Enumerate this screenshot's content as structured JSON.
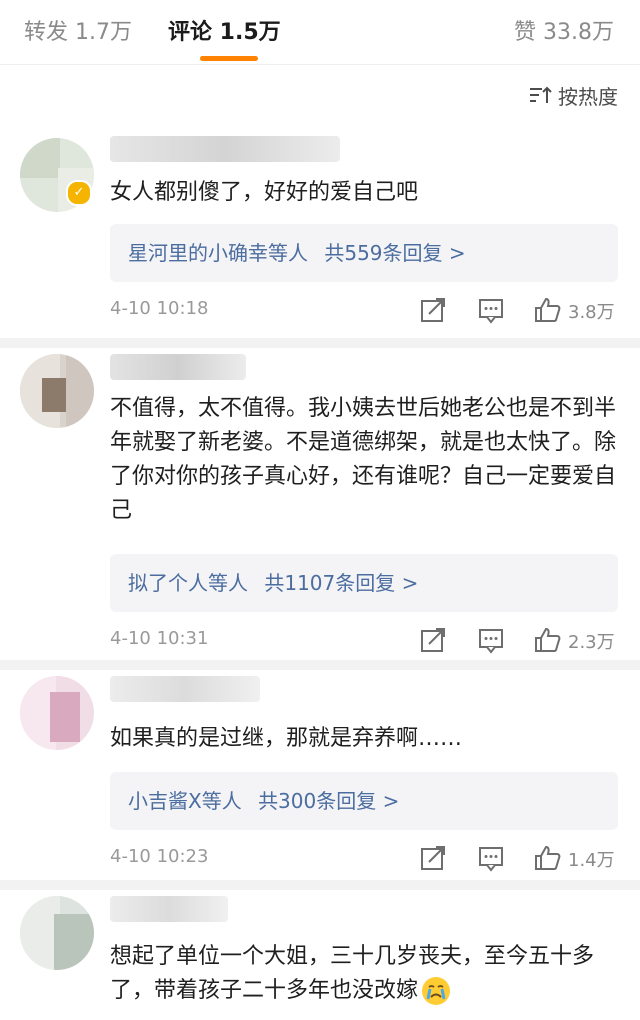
{
  "tabs": {
    "repost": "转发 1.7万",
    "comments": "评论 1.5万",
    "likes": "赞 33.8万"
  },
  "sort": {
    "label": "按热度",
    "icon": "sort-lines-icon"
  },
  "comments": [
    {
      "text": "女人都别傻了，好好的爱自己吧",
      "reply_users": "星河里的小确幸等人",
      "reply_count": "共559条回复 >",
      "time": "4-10 10:18",
      "likes": "3.8万",
      "verified": true
    },
    {
      "text": "不值得，太不值得。我小姨去世后她老公也是不到半年就娶了新老婆。不是道德绑架，就是也太快了。除了你对你的孩子真心好，还有谁呢？自己一定要爱自己",
      "reply_users": "拟了个人等人",
      "reply_count": "共1107条回复 >",
      "time": "4-10 10:31",
      "likes": "2.3万"
    },
    {
      "text": "如果真的是过继，那就是弃养啊……",
      "reply_users": "小吉酱X等人",
      "reply_count": "共300条回复 >",
      "time": "4-10 10:23",
      "likes": "1.4万"
    },
    {
      "text": "想起了单位一个大姐，三十几岁丧夫，至今五十多了，带着孩子二十多年也没改嫁",
      "emoji": "crying-face-icon"
    }
  ],
  "icons": {
    "share": "share-icon",
    "comment": "comment-icon",
    "like": "thumbs-up-icon"
  },
  "colors": {
    "accent": "#ff8200",
    "link": "#4b6da0",
    "badge": "#f5b400"
  }
}
